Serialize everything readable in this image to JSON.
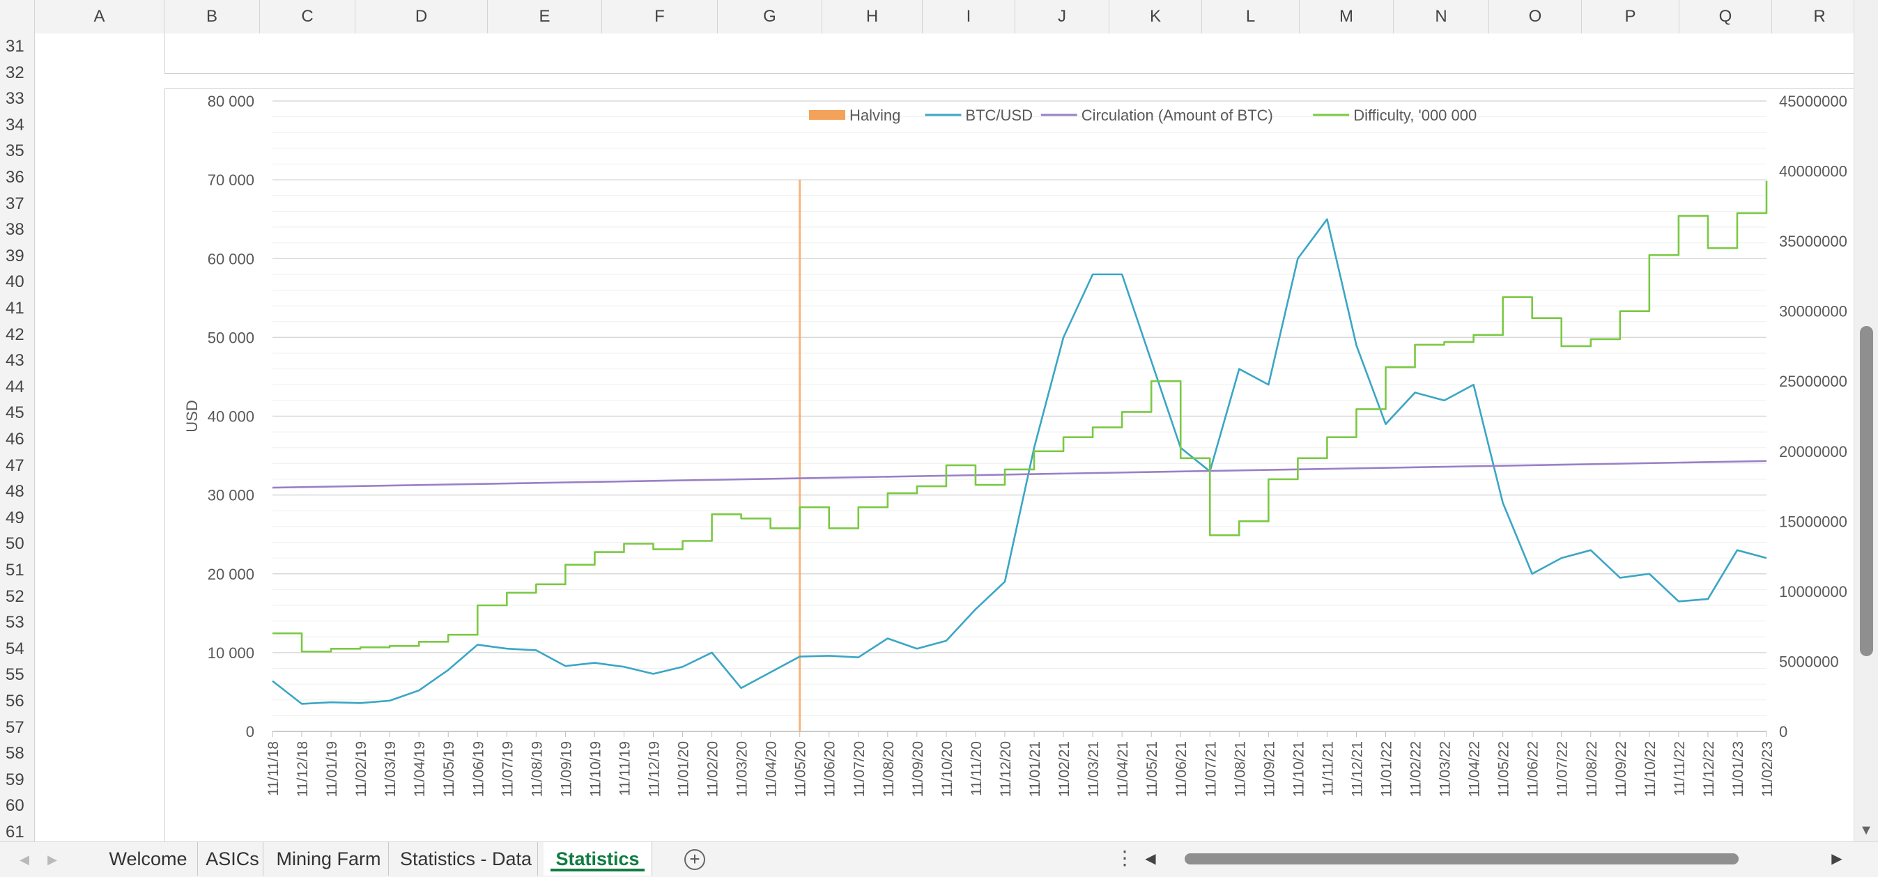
{
  "spreadsheet": {
    "columns": [
      "A",
      "B",
      "C",
      "D",
      "E",
      "F",
      "G",
      "H",
      "I",
      "J",
      "K",
      "L",
      "M",
      "N",
      "O",
      "P",
      "Q",
      "R"
    ],
    "rows": [
      31,
      32,
      33,
      34,
      35,
      36,
      37,
      38,
      39,
      40,
      41,
      42,
      43,
      44,
      45,
      46,
      47,
      48,
      49,
      50,
      51,
      52,
      53,
      54,
      55,
      56,
      57,
      58,
      59,
      60,
      61
    ],
    "tabs": [
      {
        "label": "Welcome",
        "active": false
      },
      {
        "label": "ASICs",
        "active": false
      },
      {
        "label": "Mining Farm",
        "active": false
      },
      {
        "label": "Statistics - Data",
        "active": false
      },
      {
        "label": "Statistics",
        "active": true
      }
    ],
    "add_sheet_icon": "plus-circle-icon",
    "accent_color": "#107c41"
  },
  "chart_data": {
    "type": "line",
    "ylabel": "USD",
    "ylim": [
      0,
      80000
    ],
    "y_ticks": [
      "0",
      "10 000",
      "20 000",
      "30 000",
      "40 000",
      "50 000",
      "60 000",
      "70 000",
      "80 000"
    ],
    "y2lim": [
      0,
      45000000
    ],
    "y2_ticks": [
      "0",
      "5000000",
      "10000000",
      "15000000",
      "20000000",
      "25000000",
      "30000000",
      "35000000",
      "40000000",
      "45000000"
    ],
    "x_ticks": [
      "11/11/18",
      "11/12/18",
      "11/01/19",
      "11/02/19",
      "11/03/19",
      "11/04/19",
      "11/05/19",
      "11/06/19",
      "11/07/19",
      "11/08/19",
      "11/09/19",
      "11/10/19",
      "11/11/19",
      "11/12/19",
      "11/01/20",
      "11/02/20",
      "11/03/20",
      "11/04/20",
      "11/05/20",
      "11/06/20",
      "11/07/20",
      "11/08/20",
      "11/09/20",
      "11/10/20",
      "11/11/20",
      "11/12/20",
      "11/01/21",
      "11/02/21",
      "11/03/21",
      "11/04/21",
      "11/05/21",
      "11/06/21",
      "11/07/21",
      "11/08/21",
      "11/09/21",
      "11/10/21",
      "11/11/21",
      "11/12/21",
      "11/01/22",
      "11/02/22",
      "11/03/22",
      "11/04/22",
      "11/05/22",
      "11/06/22",
      "11/07/22",
      "11/08/22",
      "11/09/22",
      "11/10/22",
      "11/11/22",
      "11/12/22",
      "11/01/23",
      "11/02/23"
    ],
    "grid": true,
    "legend_position": "top",
    "series": [
      {
        "name": "Halving",
        "kind": "bar",
        "axis": "left",
        "color": "#f4a25a",
        "x": [
          "11/05/20"
        ],
        "values": [
          70000
        ]
      },
      {
        "name": "BTC/USD",
        "kind": "line",
        "axis": "left",
        "color": "#3aa6c5",
        "x": [
          "11/11/18",
          "11/12/18",
          "11/01/19",
          "11/02/19",
          "11/03/19",
          "11/04/19",
          "11/05/19",
          "11/06/19",
          "11/07/19",
          "11/08/19",
          "11/09/19",
          "11/10/19",
          "11/11/19",
          "11/12/19",
          "11/01/20",
          "11/02/20",
          "11/03/20",
          "11/04/20",
          "11/05/20",
          "11/06/20",
          "11/07/20",
          "11/08/20",
          "11/09/20",
          "11/10/20",
          "11/11/20",
          "11/12/20",
          "11/01/21",
          "11/02/21",
          "11/03/21",
          "11/04/21",
          "11/05/21",
          "11/06/21",
          "11/07/21",
          "11/08/21",
          "11/09/21",
          "11/10/21",
          "11/11/21",
          "11/12/21",
          "11/01/22",
          "11/02/22",
          "11/03/22",
          "11/04/22",
          "11/05/22",
          "11/06/22",
          "11/07/22",
          "11/08/22",
          "11/09/22",
          "11/10/22",
          "11/11/22",
          "11/12/22",
          "11/01/23",
          "11/02/23"
        ],
        "values": [
          6400,
          3500,
          3700,
          3600,
          3900,
          5200,
          7800,
          11000,
          10500,
          10300,
          8300,
          8700,
          8200,
          7300,
          8200,
          10000,
          5500,
          7500,
          9500,
          9600,
          9400,
          11800,
          10500,
          11500,
          15500,
          19000,
          36000,
          50000,
          58000,
          58000,
          47000,
          36000,
          33000,
          46000,
          44000,
          60000,
          65000,
          49000,
          39000,
          43000,
          42000,
          44000,
          29000,
          20000,
          22000,
          23000,
          19500,
          20000,
          16500,
          16800,
          23000,
          22000
        ]
      },
      {
        "name": "Circulation (Amount of BTC)",
        "kind": "line",
        "axis": "right",
        "color": "#9a80c6",
        "x": [
          "11/11/18",
          "11/02/23"
        ],
        "values": [
          17400000,
          19300000
        ]
      },
      {
        "name": "Difficulty, '000 000",
        "kind": "step",
        "axis": "right",
        "color": "#7ac943",
        "x": [
          "11/11/18",
          "11/12/18",
          "11/01/19",
          "11/02/19",
          "11/03/19",
          "11/04/19",
          "11/05/19",
          "11/06/19",
          "11/07/19",
          "11/08/19",
          "11/09/19",
          "11/10/19",
          "11/11/19",
          "11/12/19",
          "11/01/20",
          "11/02/20",
          "11/03/20",
          "11/04/20",
          "11/05/20",
          "11/06/20",
          "11/07/20",
          "11/08/20",
          "11/09/20",
          "11/10/20",
          "11/11/20",
          "11/12/20",
          "11/01/21",
          "11/02/21",
          "11/03/21",
          "11/04/21",
          "11/05/21",
          "11/06/21",
          "11/07/21",
          "11/08/21",
          "11/09/21",
          "11/10/21",
          "11/11/21",
          "11/12/21",
          "11/01/22",
          "11/02/22",
          "11/03/22",
          "11/04/22",
          "11/05/22",
          "11/06/22",
          "11/07/22",
          "11/08/22",
          "11/09/22",
          "11/10/22",
          "11/11/22",
          "11/12/22",
          "11/01/23",
          "11/02/23"
        ],
        "values": [
          7000000,
          5700000,
          5900000,
          6000000,
          6100000,
          6400000,
          6900000,
          9000000,
          9900000,
          10500000,
          11900000,
          12800000,
          13400000,
          13000000,
          13600000,
          15500000,
          15200000,
          14500000,
          16000000,
          14500000,
          16000000,
          17000000,
          17500000,
          19000000,
          17600000,
          18700000,
          20000000,
          21000000,
          21700000,
          22800000,
          25000000,
          19500000,
          14000000,
          15000000,
          18000000,
          19500000,
          21000000,
          23000000,
          26000000,
          27600000,
          27800000,
          28300000,
          31000000,
          29500000,
          27500000,
          28000000,
          30000000,
          34000000,
          36800000,
          34500000,
          37000000,
          39300000
        ]
      }
    ]
  }
}
